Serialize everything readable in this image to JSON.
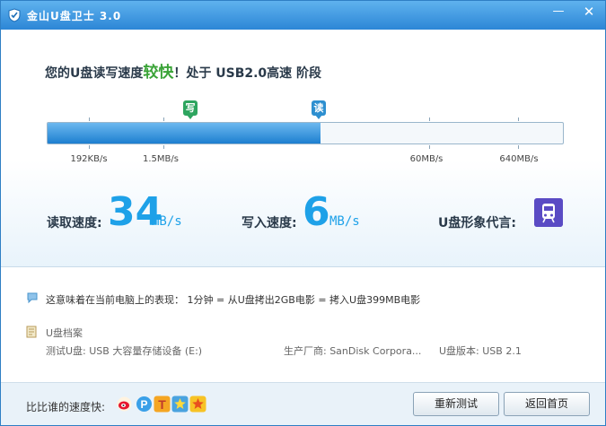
{
  "window": {
    "title": "金山U盘卫士 3.0"
  },
  "controls": {
    "minimize": "—",
    "close": "✕"
  },
  "headline": {
    "prefix": "您的U盘读写速度",
    "rating": "较快",
    "suffix": "！处于 USB2.0高速 阶段"
  },
  "scale": {
    "write_marker": "写",
    "read_marker": "读",
    "read_progress_percent": 53,
    "labels": [
      "192KB/s",
      "1.5MB/s",
      "60MB/s",
      "640MB/s"
    ]
  },
  "metrics": {
    "read_label": "读取速度:",
    "read_value": "34",
    "read_unit": "MB/s",
    "write_label": "写入速度:",
    "write_value": "6",
    "write_unit": "MB/s",
    "spokesperson_label": "U盘形象代言:"
  },
  "info": {
    "meaning": "这意味着在当前电脑上的表现： 1分钟 = 从U盘拷出2GB电影 = 拷入U盘399MB电影",
    "archive_title": "U盘档案",
    "device": "测试U盘: USB 大容量存储设备 (E:)",
    "manufacturer": "生产厂商: SanDisk Corpora...",
    "version": "U盘版本: USB 2.1"
  },
  "bottom": {
    "compare_label": "比比谁的速度快:",
    "share_icons": [
      "weibo-icon",
      "p-icon",
      "t-icon",
      "star-icon",
      "qzone-icon"
    ],
    "retest_button": "重新测试",
    "home_button": "返回首页"
  },
  "colors": {
    "accent": "#1ea1e8",
    "rating": "#3aa337",
    "titlebar": "#3b93dd"
  }
}
